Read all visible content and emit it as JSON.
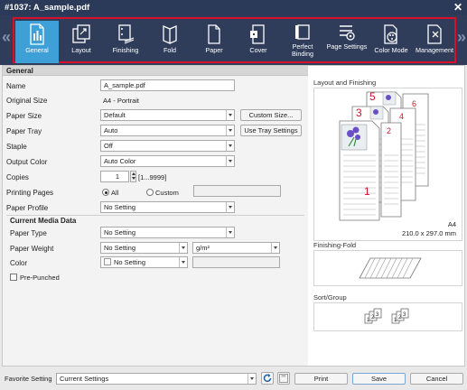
{
  "window": {
    "title": "#1037: A_sample.pdf"
  },
  "toolbar": {
    "tabs": [
      {
        "label": "General",
        "icon": "general-icon"
      },
      {
        "label": "Layout",
        "icon": "layout-icon"
      },
      {
        "label": "Finishing",
        "icon": "finishing-icon"
      },
      {
        "label": "Fold",
        "icon": "fold-icon"
      },
      {
        "label": "Paper",
        "icon": "paper-icon"
      },
      {
        "label": "Cover",
        "icon": "cover-icon"
      },
      {
        "label": "Perfect Binding",
        "icon": "perfect-binding-icon"
      },
      {
        "label": "Page Settings",
        "icon": "page-settings-icon"
      },
      {
        "label": "Color Mode",
        "icon": "color-mode-icon"
      },
      {
        "label": "Management",
        "icon": "management-icon"
      }
    ],
    "active_tab": "General",
    "prev_arrow": "«",
    "next_arrow": "»"
  },
  "general": {
    "section_title": "General",
    "name": {
      "label": "Name",
      "value": "A_sample.pdf"
    },
    "original_size": {
      "label": "Original Size",
      "value": "A4 - Portrait"
    },
    "paper_size": {
      "label": "Paper Size",
      "value": "Default",
      "button": "Custom Size..."
    },
    "paper_tray": {
      "label": "Paper Tray",
      "value": "Auto",
      "button": "Use Tray Settings"
    },
    "staple": {
      "label": "Staple",
      "value": "Off"
    },
    "output_color": {
      "label": "Output Color",
      "value": "Auto Color"
    },
    "copies": {
      "label": "Copies",
      "value": "1",
      "range": "[1...9999]"
    },
    "printing_pages": {
      "label": "Printing Pages",
      "option_all": "All",
      "option_custom": "Custom",
      "custom_value": ""
    },
    "paper_profile": {
      "label": "Paper Profile",
      "value": "No Setting"
    }
  },
  "media": {
    "section_title": "Current Media Data",
    "paper_type": {
      "label": "Paper Type",
      "value": "No Setting"
    },
    "paper_weight": {
      "label": "Paper Weight",
      "value": "No Setting",
      "unit": "g/m²",
      "extra": ""
    },
    "color": {
      "label": "Color",
      "value": "No Setting",
      "extra": ""
    },
    "pre_punched": {
      "label": "Pre-Punched",
      "checked": false
    }
  },
  "preview": {
    "layout_title": "Layout and Finishing",
    "paper_name": "A4",
    "paper_dims": "210.0 x 297.0 mm",
    "page_numbers": [
      "5",
      "6",
      "3",
      "4",
      "2",
      "1"
    ],
    "finishing_fold_title": "Finishing-Fold",
    "sort_group_title": "Sort/Group",
    "sort_numbers": [
      "1",
      "2",
      "3",
      "1",
      "2",
      "3"
    ]
  },
  "footer": {
    "favorite_label": "Favorite Setting",
    "favorite_value": "Current Settings",
    "print": "Print",
    "save": "Save",
    "cancel": "Cancel"
  },
  "colors": {
    "title_bg": "#2b3a58",
    "toolbar_bg": "#2f3d5b",
    "active_tab": "#3fa0d8",
    "highlight_frame": "#d8102a",
    "page_number": "#d2122e"
  }
}
